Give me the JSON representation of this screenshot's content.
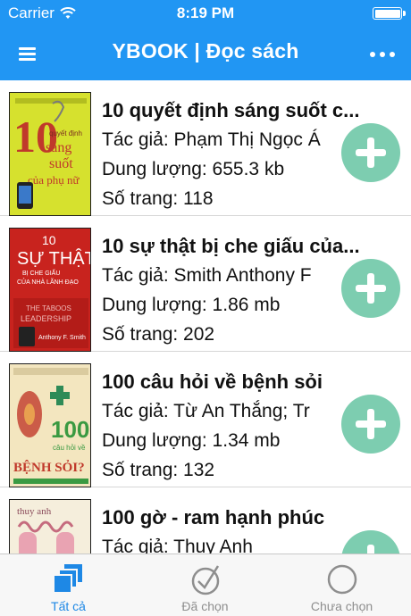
{
  "status_bar": {
    "carrier": "Carrier",
    "time": "8:19 PM"
  },
  "nav": {
    "title": "YBOOK | Đọc sách",
    "menu_icon": "hamburger-icon",
    "more_icon": "more-dots-icon"
  },
  "books": [
    {
      "title": "10 quyết định sáng suốt c...",
      "author": "Tác giả: Phạm Thị Ngọc Á",
      "size": "Dung lượng: 655.3 kb",
      "pages": "Số trang: 118",
      "cover_lines": [
        "10",
        "quyết định",
        "sáng",
        "suốt",
        "của phụ nữ"
      ]
    },
    {
      "title": "10 sự thật bị che giấu của...",
      "author": "Tác giả: Smith Anthony F",
      "size": "Dung lượng: 1.86 mb",
      "pages": "Số trang: 202",
      "cover_lines": [
        "10",
        "SỰ THẬT",
        "BỊ CHE GIẤU",
        "CỦA NHÀ LÃNH ĐẠO",
        "THE TABOOS",
        "LEADERSHIP",
        "Anthony F. Smith"
      ]
    },
    {
      "title": "100 câu hỏi về bệnh sỏi",
      "author": "Tác giả: Từ An Thắng; Tr",
      "size": "Dung lượng: 1.34 mb",
      "pages": "Số trang: 132",
      "cover_lines": [
        "100",
        "câu hỏi về",
        "BỆNH SỎI?"
      ]
    },
    {
      "title": "100 gờ - ram hạnh phúc",
      "author": "Tác giả: Thuy Anh",
      "size": "",
      "pages": "",
      "cover_lines": [
        "thuy anh"
      ]
    }
  ],
  "tabs": [
    {
      "label": "Tất cả",
      "icon": "stacked-squares-icon",
      "active": true
    },
    {
      "label": "Đã chọn",
      "icon": "checkmark-circle-icon",
      "active": false
    },
    {
      "label": "Chưa chọn",
      "icon": "empty-circle-icon",
      "active": false
    }
  ],
  "colors": {
    "primary": "#2196f3",
    "add_button": "#7dcdb0",
    "tab_active": "#1e88e5",
    "tab_inactive": "#8e8e8e"
  }
}
